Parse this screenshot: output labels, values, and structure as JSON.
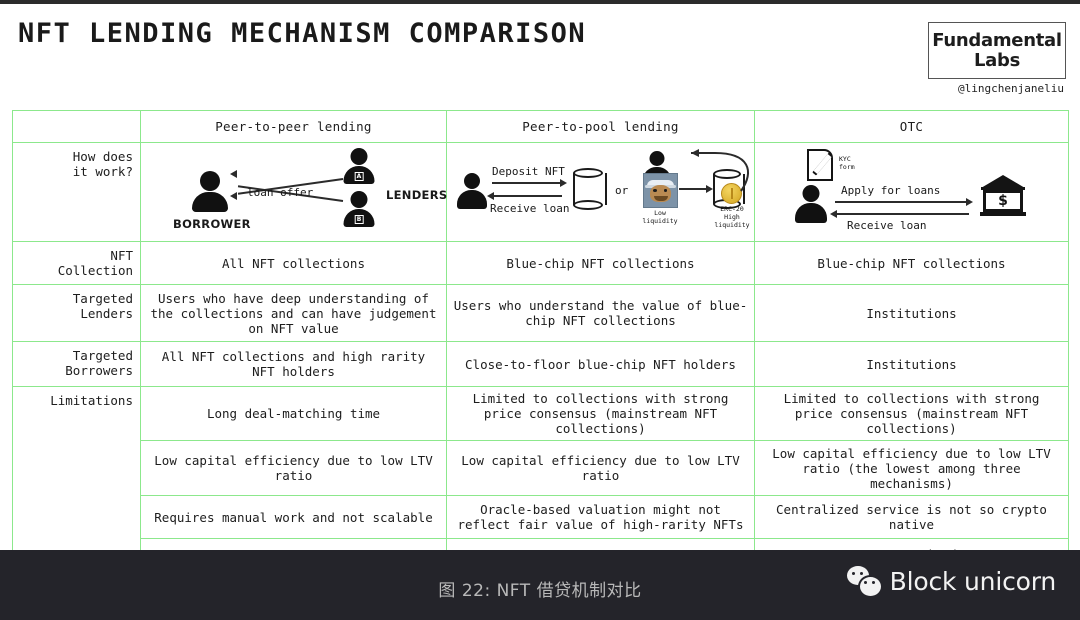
{
  "header": {
    "title": "NFT LENDING MECHANISM COMPARISON",
    "logo_line1": "Fundamental",
    "logo_line2": "Labs",
    "handle": "@lingchenjaneliu"
  },
  "colors": {
    "green": "#7ce07c",
    "border_green": "#8ce88c",
    "text": "#1d1d1d",
    "footer_bg": "#24242a"
  },
  "table": {
    "columns": [
      "",
      "Peer-to-peer lending",
      "Peer-to-pool lending",
      "OTC"
    ],
    "row_labels": {
      "how": "How does\nit work?",
      "how_l1": "How does",
      "how_l2": "it work?",
      "nft_collection_l1": "NFT",
      "nft_collection_l2": "Collection",
      "targeted_lenders_l1": "Targeted",
      "targeted_lenders_l2": "Lenders",
      "targeted_borrowers_l1": "Targeted",
      "targeted_borrowers_l2": "Borrowers",
      "limitations": "Limitations"
    },
    "rows": [
      {
        "label": "NFT Collection",
        "cells": [
          "All NFT collections",
          "Blue-chip NFT collections",
          "Blue-chip NFT collections"
        ]
      },
      {
        "label": "Targeted Lenders",
        "cells": [
          "Users who have deep understanding of the collections and can have judgement on NFT value",
          "Users who understand the value of blue-chip NFT collections",
          "Institutions"
        ]
      },
      {
        "label": "Targeted Borrowers",
        "cells": [
          "All NFT collections and high rarity NFT holders",
          "Close-to-floor blue-chip NFT holders",
          "Institutions"
        ]
      }
    ],
    "limitations": [
      {
        "cells": [
          "Long deal-matching time",
          "Limited to collections with strong price consensus (mainstream NFT collections)",
          "Limited to collections with strong price consensus (mainstream NFT collections)"
        ]
      },
      {
        "cells": [
          "Low capital efficiency due to low LTV ratio",
          "Low capital efficiency due to low LTV ratio",
          "Low capital efficiency due to low LTV ratio (the lowest among three mechanisms)"
        ]
      },
      {
        "cells": [
          "Requires manual work and not scalable",
          "Oracle-based valuation might not reflect fair value of high-rarity NFTs",
          "Centralized service is not so crypto native"
        ]
      },
      {
        "cells": [
          "/",
          "/",
          "KYC required"
        ]
      }
    ]
  },
  "diagrams": {
    "p2p": {
      "borrower_label": "BORROWER",
      "lenders_label": "LENDERS",
      "arrow_label": "loan offer",
      "lender_a": "A",
      "lender_b": "B"
    },
    "p2pool": {
      "deposit_label": "Deposit NFT",
      "receive_label": "Receive loan",
      "or_label": "or",
      "nft_label_l1": "Low",
      "nft_label_l2": "liquidity",
      "token_label_l1": "ERC-20",
      "token_label_l2": "High",
      "token_label_l3": "liquidity"
    },
    "otc": {
      "kyc_l1": "KYC",
      "kyc_l2": "form",
      "apply_label": "Apply for loans",
      "receive_label": "Receive loan",
      "bank_symbol": "$"
    }
  },
  "footer": {
    "caption": "图 22: NFT 借贷机制对比",
    "brand": "Block unicorn"
  }
}
